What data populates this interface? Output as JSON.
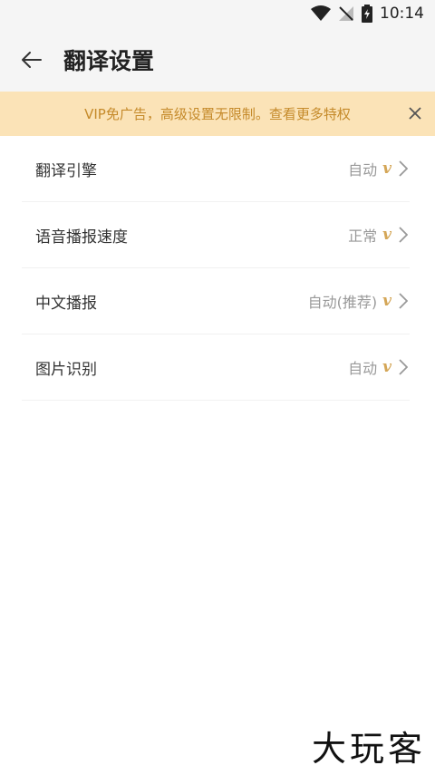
{
  "status_bar": {
    "time": "10:14"
  },
  "header": {
    "title": "翻译设置"
  },
  "banner": {
    "text": "VIP免广告，高级设置无限制。查看更多特权"
  },
  "settings": [
    {
      "label": "翻译引擎",
      "value": "自动",
      "badge": "v"
    },
    {
      "label": "语音播报速度",
      "value": "正常",
      "badge": "v"
    },
    {
      "label": "中文播报",
      "value": "自动(推荐)",
      "badge": "v"
    },
    {
      "label": "图片识别",
      "value": "自动",
      "badge": "v"
    }
  ],
  "watermark": "大玩客",
  "colors": {
    "banner_bg": "#fbe3b7",
    "banner_text": "#c58a2a",
    "vip_gold": "#d4a657"
  }
}
